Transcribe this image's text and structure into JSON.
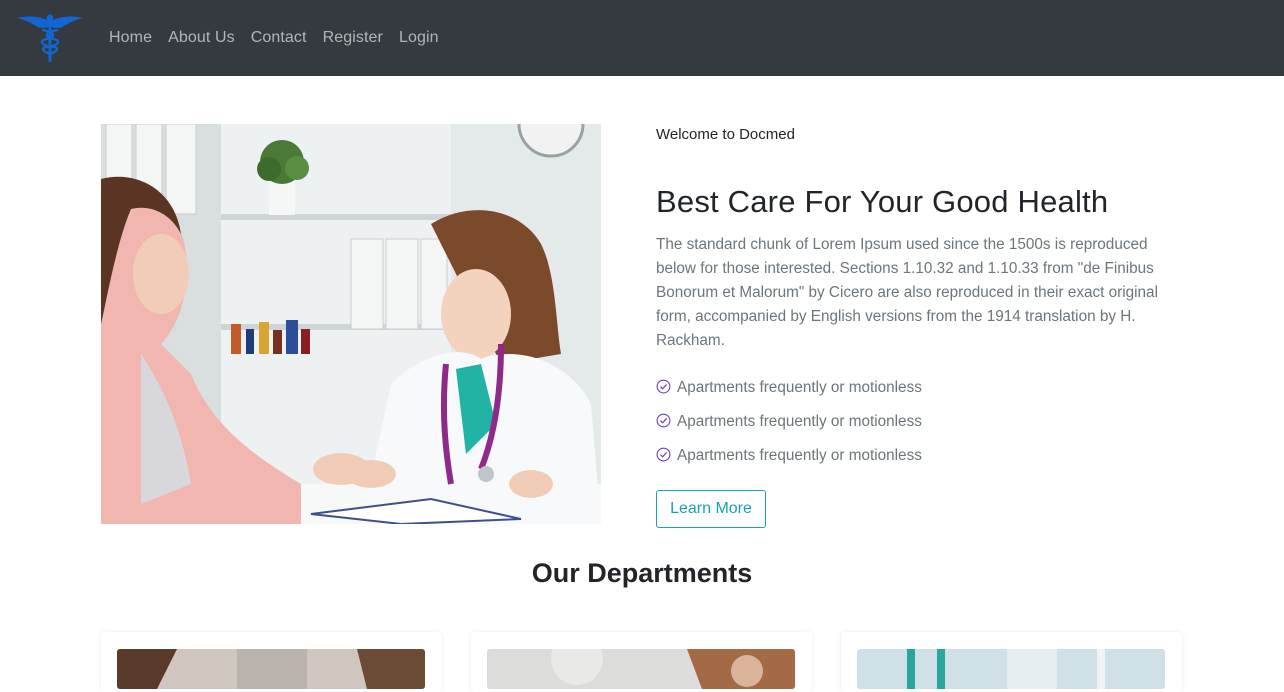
{
  "nav": {
    "logo_icon": "caduceus-icon",
    "items": [
      {
        "label": "Home"
      },
      {
        "label": "About Us"
      },
      {
        "label": "Contact"
      },
      {
        "label": "Register"
      },
      {
        "label": "Login"
      }
    ]
  },
  "hero": {
    "welcome": "Welcome to Docmed",
    "title": "Best Care For Your Good Health",
    "paragraph": "The standard chunk of Lorem Ipsum used since the 1500s is reproduced below for those interested. Sections 1.10.32 and 1.10.33 from \"de Finibus Bonorum et Malorum\" by Cicero are also reproduced in their exact original form, accompanied by English versions from the 1914 translation by H. Rackham.",
    "features": [
      "Apartments frequently or motionless",
      "Apartments frequently or motionless",
      "Apartments frequently or motionless"
    ],
    "button_label": "Learn More"
  },
  "departments": {
    "title": "Our Departments"
  },
  "colors": {
    "navbar": "#343a40",
    "accent": "#17a2b8",
    "check": "#6f42c1",
    "logo": "#0d6efd"
  }
}
